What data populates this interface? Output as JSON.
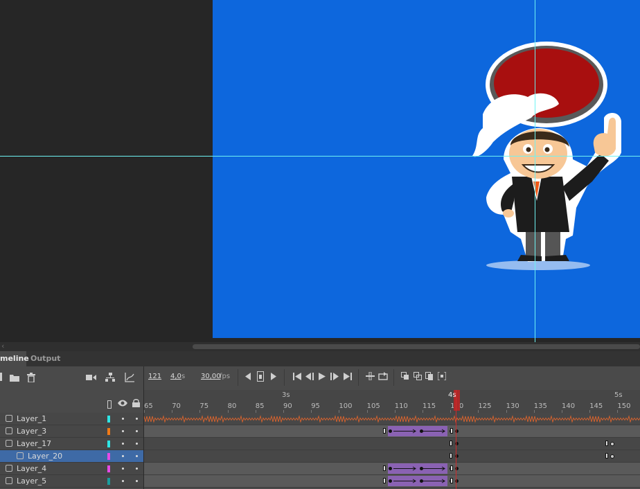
{
  "tabs": [
    {
      "label": "meline",
      "active": true
    },
    {
      "label": "Output",
      "active": false
    }
  ],
  "layer_toolbar_icons": [
    "new-layer-icon",
    "new-folder-icon",
    "delete-icon"
  ],
  "layer_toolbar_right_icons": [
    "camera-icon",
    "parenting-icon",
    "graph-icon"
  ],
  "layer_header_icons": [
    "outline-icon",
    "eye-icon",
    "lock-icon"
  ],
  "controls": {
    "frame": "121",
    "time": "4,0",
    "time_unit": "s",
    "fps": "30,00",
    "fps_unit": "fps"
  },
  "ruler": {
    "seconds": [
      {
        "label": "3s"
      },
      {
        "label": "4s"
      },
      {
        "label": "5s"
      }
    ],
    "frames": [
      "65",
      "70",
      "75",
      "80",
      "85",
      "90",
      "95",
      "100",
      "105",
      "110",
      "115",
      "120",
      "125",
      "130",
      "135",
      "140",
      "145",
      "150"
    ]
  },
  "layers": [
    {
      "name": "Layer_1",
      "color": "#2ee6e6",
      "selected": false,
      "type": "audio"
    },
    {
      "name": "Layer_3",
      "color": "#f07a17",
      "selected": false,
      "type": "tween"
    },
    {
      "name": "Layer_17",
      "color": "#2ee6e6",
      "selected": false,
      "type": "parent"
    },
    {
      "name": "Layer_20",
      "color": "#e64ae6",
      "selected": true,
      "type": "child"
    },
    {
      "name": "Layer_4",
      "color": "#e64ae6",
      "selected": false,
      "type": "tween"
    },
    {
      "name": "Layer_5",
      "color": "#1a9e9e",
      "selected": false,
      "type": "tween"
    }
  ],
  "playhead_frame": "4s",
  "colors": {
    "stage": "#0d67dd",
    "guide": "#6ef3f3",
    "tween": "#8a62b3",
    "playhead": "#d02a2a",
    "selection": "#3e6aa6"
  }
}
